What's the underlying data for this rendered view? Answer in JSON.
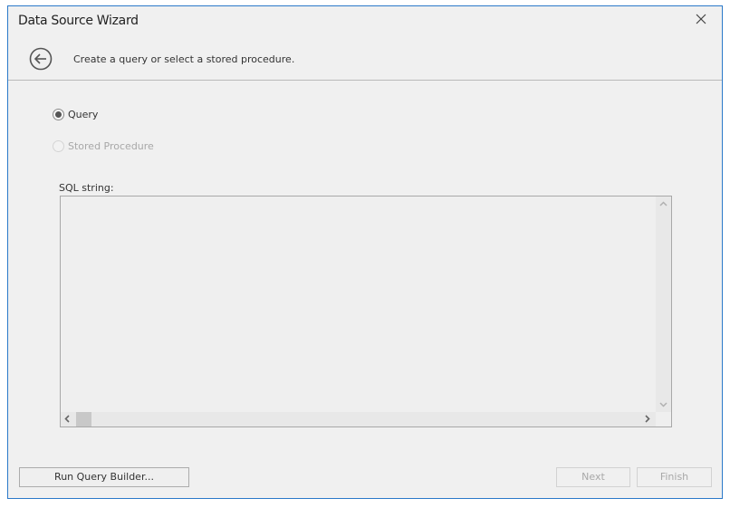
{
  "window": {
    "title": "Data Source Wizard",
    "close_icon": "close-icon",
    "accent_color": "#2b79c9"
  },
  "header": {
    "back_icon": "arrow-left-circle-icon",
    "subtitle": "Create a query or select a stored procedure."
  },
  "options": [
    {
      "label": "Query",
      "checked": true,
      "enabled": true
    },
    {
      "label": "Stored Procedure",
      "checked": false,
      "enabled": false
    }
  ],
  "sql": {
    "label": "SQL string:",
    "value": ""
  },
  "scrollbars": {
    "up_icon": "chevron-up-icon",
    "down_icon": "chevron-down-icon",
    "left_icon": "chevron-left-icon",
    "right_icon": "chevron-right-icon"
  },
  "footer": {
    "run_query_builder": "Run Query Builder...",
    "next": "Next",
    "finish": "Finish"
  }
}
